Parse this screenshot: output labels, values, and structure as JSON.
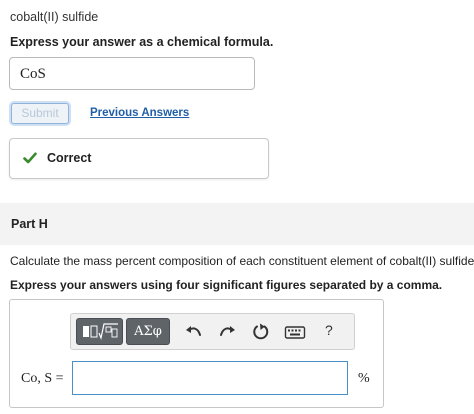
{
  "prev_question": {
    "title": "cobalt(II) sulfide",
    "instruction": "Express your answer as a chemical formula.",
    "answer_value": "CoS",
    "submit_label": "Submit",
    "previous_answers_label": "Previous Answers",
    "feedback": {
      "status_icon": "check-icon",
      "label": "Correct",
      "color": "#3c8a2e"
    }
  },
  "part_h": {
    "title": "Part H",
    "question": "Calculate the mass percent composition of each constituent element of cobalt(II) sulfide.",
    "instruction": "Express your answers using four significant figures separated by a comma.",
    "toolbar": {
      "buttons": [
        {
          "name": "templates",
          "icon": "templates-icon"
        },
        {
          "name": "symbols",
          "label": "ΑΣφ",
          "icon": "greek-symbols-icon"
        },
        {
          "name": "undo",
          "icon": "undo-icon"
        },
        {
          "name": "redo",
          "icon": "redo-icon"
        },
        {
          "name": "reset",
          "icon": "reset-icon"
        },
        {
          "name": "keyboard",
          "icon": "keyboard-icon"
        },
        {
          "name": "help",
          "label": "?",
          "icon": "help-icon"
        }
      ]
    },
    "input_label": "Co, S =",
    "input_value": "",
    "unit": "%"
  },
  "colors": {
    "link": "#1f5fa8",
    "input_focus_border": "#4a8fc6",
    "toolbar_dark": "#5f6469",
    "part_band": "#f3f3f3"
  }
}
